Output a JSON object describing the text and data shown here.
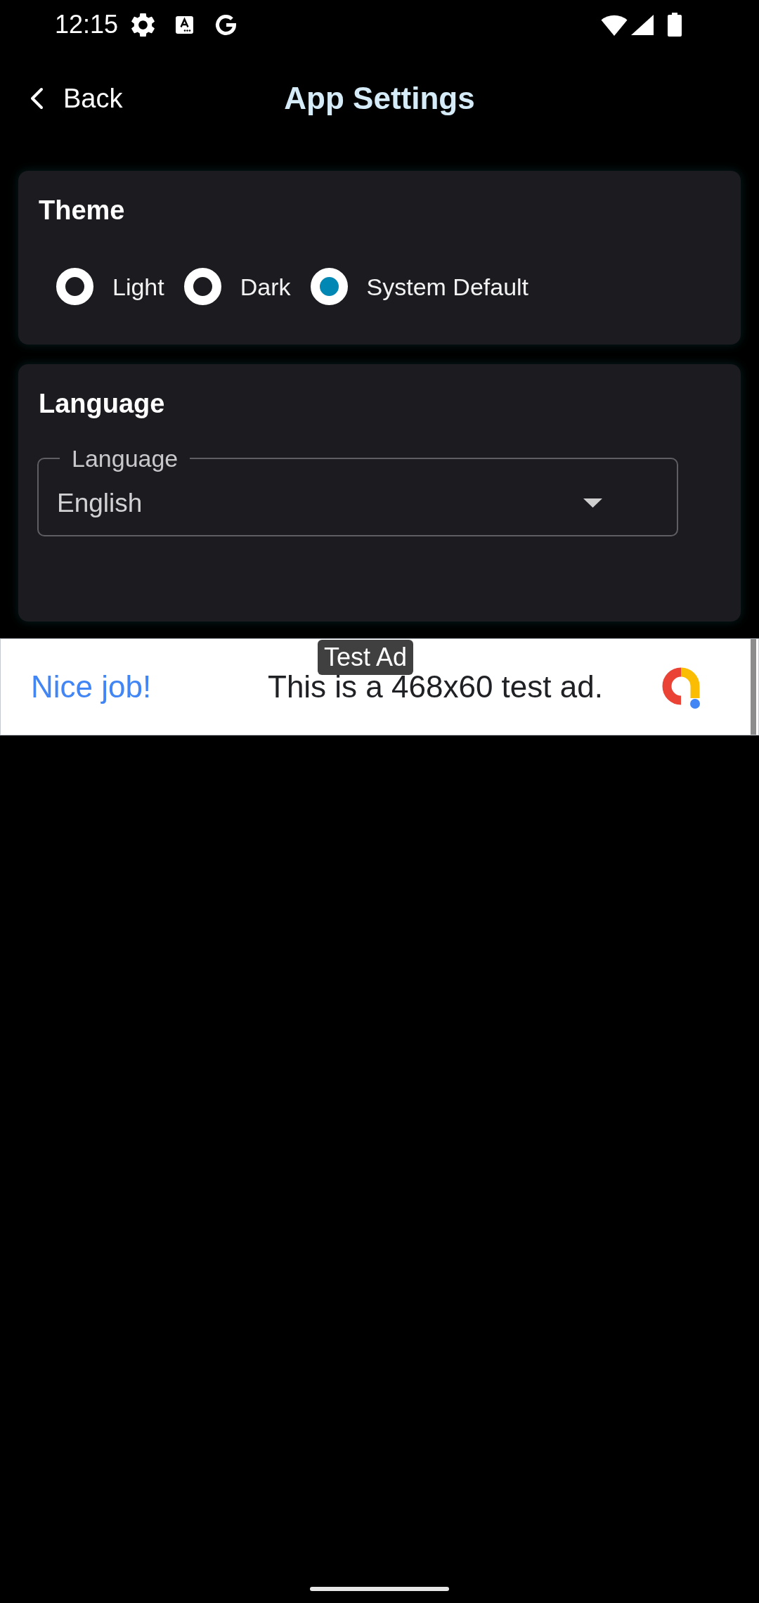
{
  "status_bar": {
    "time": "12:15"
  },
  "header": {
    "back": "Back",
    "title": "App Settings"
  },
  "sections": [
    {
      "kind": "radio_group",
      "title": "Theme",
      "options": [
        {
          "label": "Light",
          "selected": false
        },
        {
          "label": "Dark",
          "selected": false
        },
        {
          "label": "System Default",
          "selected": true
        }
      ]
    },
    {
      "kind": "dropdown",
      "title": "Language",
      "field": {
        "label": "Language",
        "value": "English"
      }
    }
  ],
  "ad": {
    "badge": "Test Ad",
    "headline": "Nice job!",
    "text": "This is a 468x60 test ad."
  }
}
